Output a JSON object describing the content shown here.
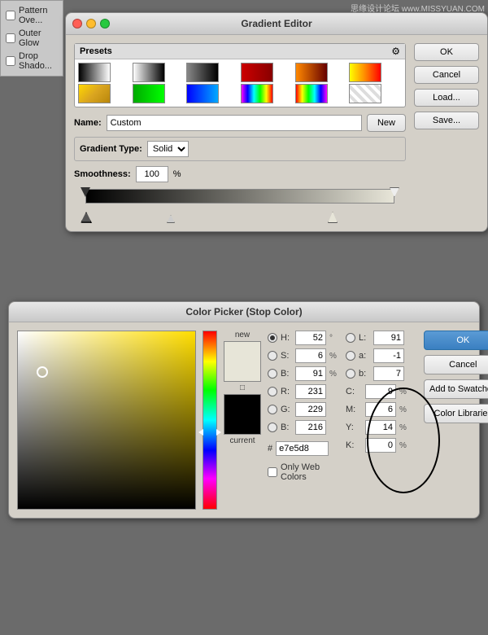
{
  "watermark": "思缘设计论坛 www.MISSYUAN.COM",
  "layer_panel": {
    "items": [
      {
        "label": "Pattern Ove...",
        "checked": false
      },
      {
        "label": "Outer Glow",
        "checked": false
      },
      {
        "label": "Drop Shado...",
        "checked": false
      }
    ]
  },
  "gradient_editor": {
    "title": "Gradient Editor",
    "buttons": {
      "ok": "OK",
      "cancel": "Cancel",
      "load": "Load...",
      "save": "Save..."
    },
    "presets": {
      "label": "Presets",
      "swatches": 12
    },
    "name_label": "Name:",
    "name_value": "Custom",
    "new_button": "New",
    "gradient_type_label": "Gradient Type:",
    "gradient_type_value": "Solid",
    "smoothness_label": "Smoothness:",
    "smoothness_value": "100",
    "smoothness_unit": "%"
  },
  "color_picker": {
    "title": "Color Picker (Stop Color)",
    "buttons": {
      "ok": "OK",
      "cancel": "Cancel",
      "add_to_swatches": "Add to Swatches",
      "color_libraries": "Color Libraries"
    },
    "swatch_new_label": "new",
    "swatch_current_label": "current",
    "fields": {
      "H": {
        "value": "52",
        "unit": "°",
        "selected": true
      },
      "S": {
        "value": "6",
        "unit": "%"
      },
      "B": {
        "value": "91",
        "unit": "%"
      },
      "R": {
        "value": "231",
        "unit": ""
      },
      "G": {
        "value": "229",
        "unit": ""
      },
      "Bval": {
        "value": "216",
        "unit": ""
      }
    },
    "lab_fields": {
      "L": {
        "value": "91"
      },
      "a": {
        "value": "-1"
      },
      "b": {
        "value": "7"
      }
    },
    "cmyk_fields": {
      "C": {
        "value": "9",
        "unit": "%"
      },
      "M": {
        "value": "6",
        "unit": "%"
      },
      "Y": {
        "value": "14",
        "unit": "%"
      },
      "K": {
        "value": "0",
        "unit": "%"
      }
    },
    "hex_label": "#",
    "hex_value": "e7e5d8",
    "only_web_colors": "Only Web Colors"
  }
}
